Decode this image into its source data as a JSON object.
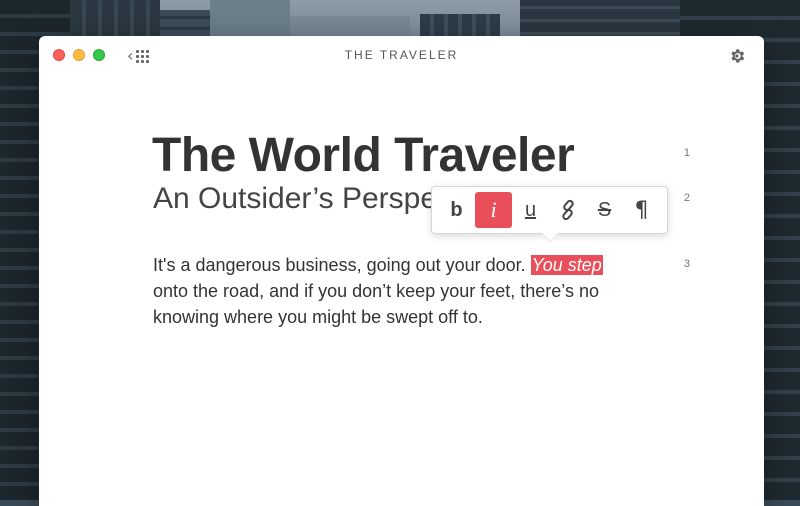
{
  "window": {
    "title": "THE TRAVELER"
  },
  "document": {
    "title": "The World Traveler",
    "subtitle": "An Outsider’s Perspe",
    "body_before": "It's a dangerous business, going out your door. ",
    "body_selected": "You step",
    "body_after": " onto the road, and if you don’t keep your feet, there’s no knowing where you might be swept off to.",
    "line_numbers": [
      "1",
      "2",
      "3"
    ]
  },
  "format_toolbar": {
    "bold": "b",
    "italic": "i",
    "underline": "u",
    "strikethrough": "S",
    "paragraph": "¶",
    "active": "italic",
    "accent_color": "#e94f5a"
  },
  "icons": {
    "back": "chevron-left-icon",
    "grid": "grid-icon",
    "settings": "gear-icon",
    "link": "link-icon"
  }
}
